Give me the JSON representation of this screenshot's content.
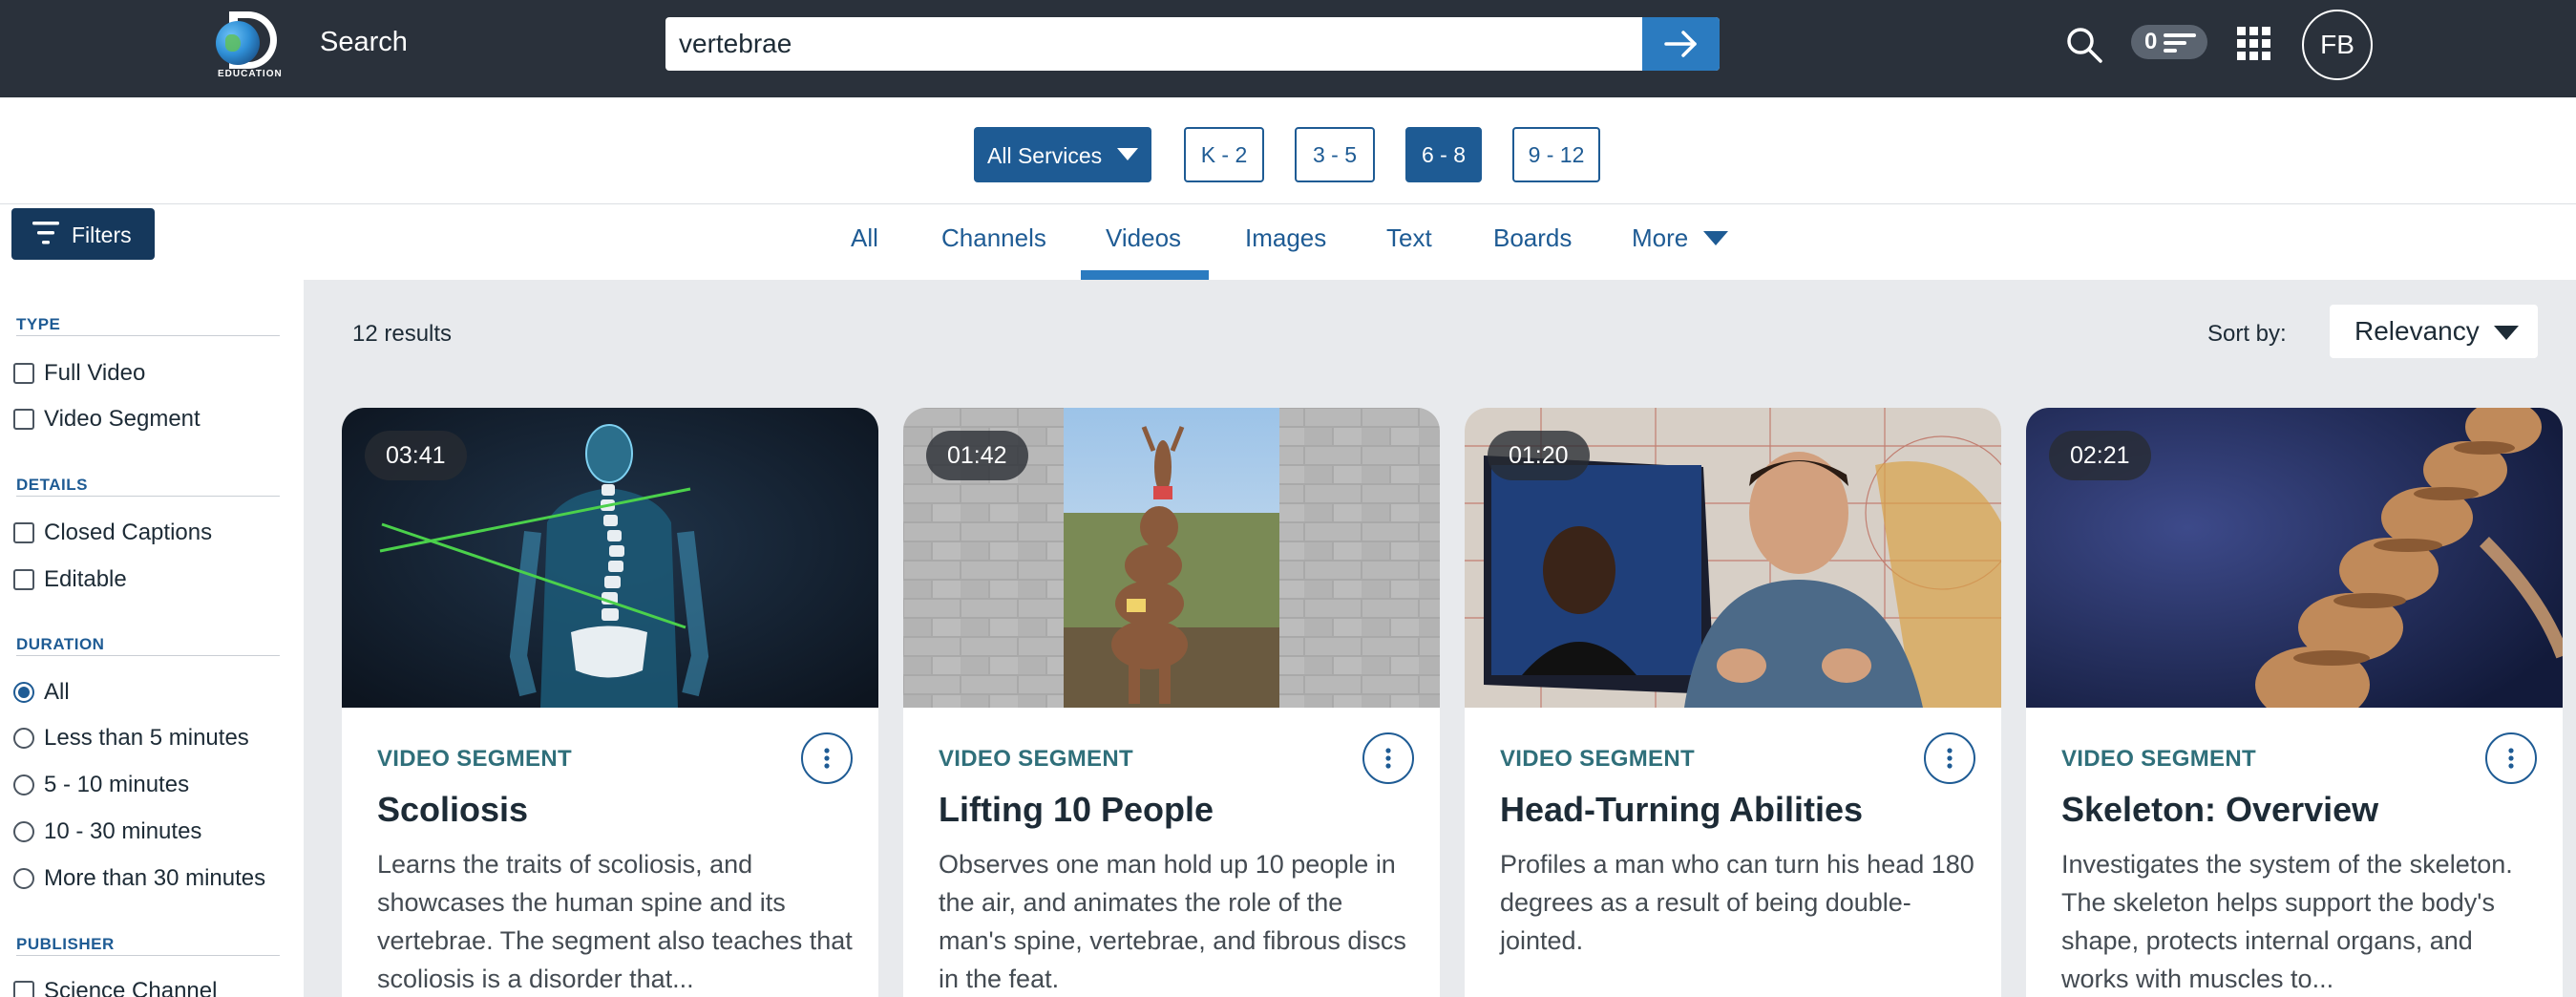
{
  "header": {
    "logo_text": "EDUCATION",
    "search_label": "Search",
    "search_value": "vertebrae",
    "list_count": "0",
    "avatar_initials": "FB"
  },
  "grades": {
    "services_label": "All Services",
    "levels": [
      "K - 2",
      "3 - 5",
      "6 - 8",
      "9 - 12"
    ],
    "active": "6 - 8"
  },
  "filters_label": "Filters",
  "tabs": [
    "All",
    "Channels",
    "Videos",
    "Images",
    "Text",
    "Boards",
    "More"
  ],
  "active_tab": "Videos",
  "sidebar": {
    "type_title": "TYPE",
    "type_options": [
      "Full Video",
      "Video Segment"
    ],
    "details_title": "DETAILS",
    "details_options": [
      "Closed Captions",
      "Editable"
    ],
    "duration_title": "DURATION",
    "duration_options": [
      "All",
      "Less than 5 minutes",
      "5 - 10 minutes",
      "10 - 30 minutes",
      "More than 30 minutes"
    ],
    "duration_selected": "All",
    "publisher_title": "PUBLISHER",
    "publisher_options": [
      "Science Channel"
    ]
  },
  "results": {
    "count_text": "12 results",
    "sort_label": "Sort by:",
    "sort_value": "Relevancy",
    "cards": [
      {
        "duration": "03:41",
        "type": "VIDEO SEGMENT",
        "title": "Scoliosis",
        "description": "Learns the traits of scoliosis, and showcases the human spine and its vertebrae. The segment also teaches that scoliosis is a disorder that..."
      },
      {
        "duration": "01:42",
        "type": "VIDEO SEGMENT",
        "title": "Lifting 10 People",
        "description": "Observes one man hold up 10 people in the air, and animates the role of the man's spine, vertebrae, and fibrous discs in the feat."
      },
      {
        "duration": "01:20",
        "type": "VIDEO SEGMENT",
        "title": "Head-Turning Abilities",
        "description": "Profiles a man who can turn his head 180 degrees as a result of being double-jointed."
      },
      {
        "duration": "02:21",
        "type": "VIDEO SEGMENT",
        "title": "Skeleton: Overview",
        "description": "Investigates the system of the skeleton. The skeleton helps support the body's shape, protects internal organs, and works with muscles to..."
      }
    ]
  },
  "colors": {
    "topbar": "#2a313b",
    "accent": "#1e5b94",
    "go_button": "#2b7bc0",
    "card_type": "#2f6f7a"
  }
}
